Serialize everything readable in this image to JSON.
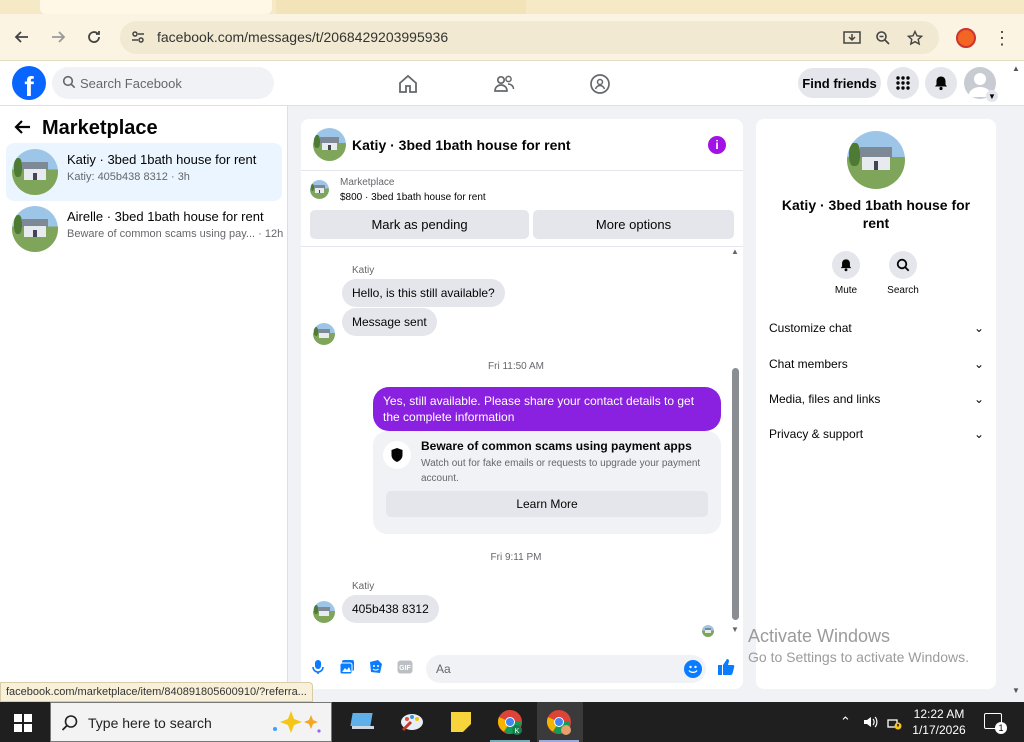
{
  "browser": {
    "url": "facebook.com/messages/t/2068429203995936",
    "status_url": "facebook.com/marketplace/item/840891805600910/?referra..."
  },
  "fb": {
    "search_placeholder": "Search Facebook",
    "find_friends": "Find friends"
  },
  "left": {
    "title": "Marketplace",
    "conversations": [
      {
        "name": "Katiy · 3bed 1bath house for rent",
        "preview": "Katiy: 405b438 8312 · 3h"
      },
      {
        "name": "Airelle · 3bed 1bath house for rent",
        "preview": "Beware of common scams using pay... · 12h"
      }
    ]
  },
  "chat": {
    "title": "Katiy · 3bed 1bath house for rent",
    "listing_label": "Marketplace",
    "listing_price": "$800 · 3bed 1bath house for rent",
    "mark_pending": "Mark as pending",
    "more_options": "More options",
    "messages": {
      "sender1": "Katiy",
      "msg1": "Hello, is this still available?",
      "msg2": "Message sent",
      "time1": "Fri 11:50 AM",
      "out1": "Yes, still available. Please share your contact details to get the complete information",
      "scam_title": "Beware of common scams using payment apps",
      "scam_body": "Watch out for fake emails or requests to upgrade your payment account.",
      "learn_more": "Learn More",
      "time2": "Fri 9:11 PM",
      "sender2": "Katiy",
      "msg3": "405b438 8312"
    },
    "composer_placeholder": "Aa"
  },
  "right": {
    "title": "Katiy · 3bed 1bath house for rent",
    "mute": "Mute",
    "search": "Search",
    "rows": [
      "Customize chat",
      "Chat members",
      "Media, files and links",
      "Privacy & support"
    ]
  },
  "watermark": {
    "line1": "Activate Windows",
    "line2": "Go to Settings to activate Windows."
  },
  "taskbar": {
    "search_placeholder": "Type here to search",
    "time": "12:22 AM",
    "date": "1/17/2026",
    "notifications": "1"
  },
  "colors": {
    "fb_blue": "#0866ff",
    "outgoing_bubble": "#8a20e0",
    "info_purple": "#a112e6"
  }
}
